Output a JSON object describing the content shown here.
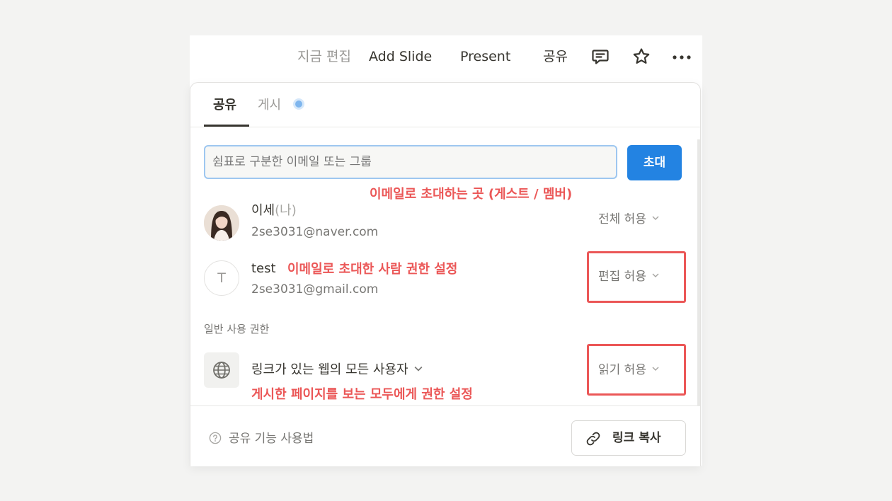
{
  "topbar": {
    "edited": "지금 편집",
    "add_slide": "Add Slide",
    "present": "Present",
    "share": "공유",
    "icons": [
      "comment-icon",
      "star-icon",
      "more-icon"
    ]
  },
  "tabs": [
    {
      "label": "공유",
      "active": true
    },
    {
      "label": "게시",
      "active": false
    }
  ],
  "invite": {
    "placeholder": "쉼표로 구분한 이메일 또는 그룹",
    "button": "초대"
  },
  "annotations": {
    "invite_area": "이메일로 초대하는 곳 (게스트 / 멤버)",
    "invited_person": "이메일로 초대한 사람 권한 설정",
    "web_access": "게시한 페이지를 보는 모두에게 권한 설정"
  },
  "members": [
    {
      "name": "이세",
      "suffix": "(나)",
      "email": "2se3031@naver.com",
      "permission": "전체 허용",
      "avatar": "photo"
    },
    {
      "name": "test",
      "suffix": "",
      "email": "2se3031@gmail.com",
      "permission": "편집 허용",
      "avatar": "T"
    }
  ],
  "general_access": {
    "section_label": "일반 사용 권한",
    "scope": "링크가 있는 웹의 모든 사용자",
    "permission": "읽기 허용"
  },
  "footer": {
    "help": "공유 기능 사용법",
    "copy_link": "링크 복사"
  },
  "colors": {
    "accent": "#2383e2",
    "annotation": "#eb5757",
    "text": "#37352f",
    "muted": "#787774"
  }
}
